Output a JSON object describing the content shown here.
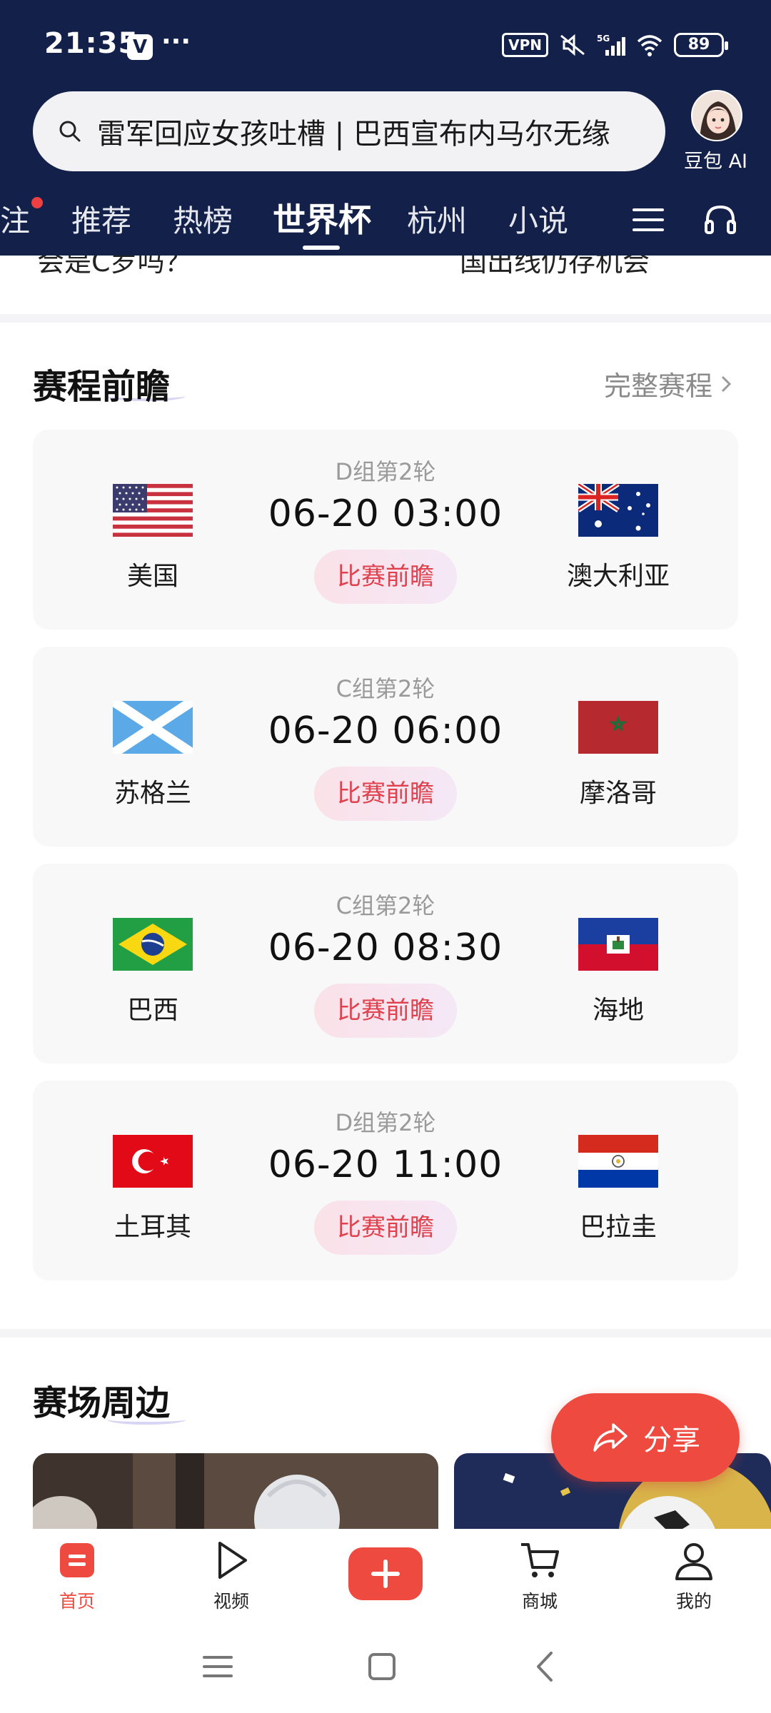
{
  "status_bar": {
    "time": "21:35",
    "app_icon": "V",
    "dots": "···",
    "vpn": "VPN",
    "network": "5G",
    "battery": "89"
  },
  "search": {
    "query": "雷军回应女孩吐槽 | 巴西宣布内马尔无缘"
  },
  "ai_assistant": {
    "label": "豆包 AI"
  },
  "tabs": [
    {
      "label": "注"
    },
    {
      "label": "推荐"
    },
    {
      "label": "热榜"
    },
    {
      "label": "世界杯"
    },
    {
      "label": "杭州"
    },
    {
      "label": "小说"
    }
  ],
  "peek": {
    "left": "会是C罗吗？",
    "right": "国出线仍存机会"
  },
  "schedule": {
    "title": "赛程前瞻",
    "more": "完整赛程",
    "preview_label": "比赛前瞻",
    "matches": [
      {
        "round": "D组第2轮",
        "time": "06-20 03:00",
        "home": "美国",
        "away": "澳大利亚"
      },
      {
        "round": "C组第2轮",
        "time": "06-20 06:00",
        "home": "苏格兰",
        "away": "摩洛哥"
      },
      {
        "round": "C组第2轮",
        "time": "06-20 08:30",
        "home": "巴西",
        "away": "海地"
      },
      {
        "round": "D组第2轮",
        "time": "06-20 11:00",
        "home": "土耳其",
        "away": "巴拉圭"
      }
    ]
  },
  "venue": {
    "title": "赛场周边"
  },
  "share": {
    "label": "分享"
  },
  "bottom_nav": [
    {
      "label": "首页",
      "icon": "home-icon",
      "active": true
    },
    {
      "label": "视频",
      "icon": "play-icon"
    },
    {
      "label": "",
      "icon": "plus-icon"
    },
    {
      "label": "商城",
      "icon": "cart-icon"
    },
    {
      "label": "我的",
      "icon": "person-icon"
    }
  ],
  "colors": {
    "header_bg": "#13204a",
    "accent": "#ee4a40",
    "preview_text": "#e0414d"
  }
}
